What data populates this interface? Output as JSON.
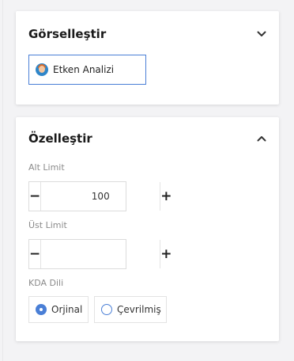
{
  "visualize_panel": {
    "title": "Görselleştir",
    "toggle_icon": "chevron-down-icon",
    "selected_option": "Etken Analizi",
    "option_icon": "person-avatar-icon"
  },
  "customize_panel": {
    "title": "Özelleştir",
    "toggle_icon": "chevron-up-icon",
    "lower_limit": {
      "label": "Alt Limit",
      "value": "100",
      "decrement_symbol": "−",
      "increment_symbol": "+"
    },
    "upper_limit": {
      "label": "Üst Limit",
      "value": "",
      "decrement_symbol": "−",
      "increment_symbol": "+"
    },
    "kda_language": {
      "label": "KDA Dili",
      "options": [
        {
          "label": "Orjinal",
          "selected": true
        },
        {
          "label": "Çevrilmiş",
          "selected": false
        }
      ]
    }
  },
  "colors": {
    "accent": "#4a7fd6",
    "background": "#f3f3f5",
    "card": "#ffffff"
  }
}
